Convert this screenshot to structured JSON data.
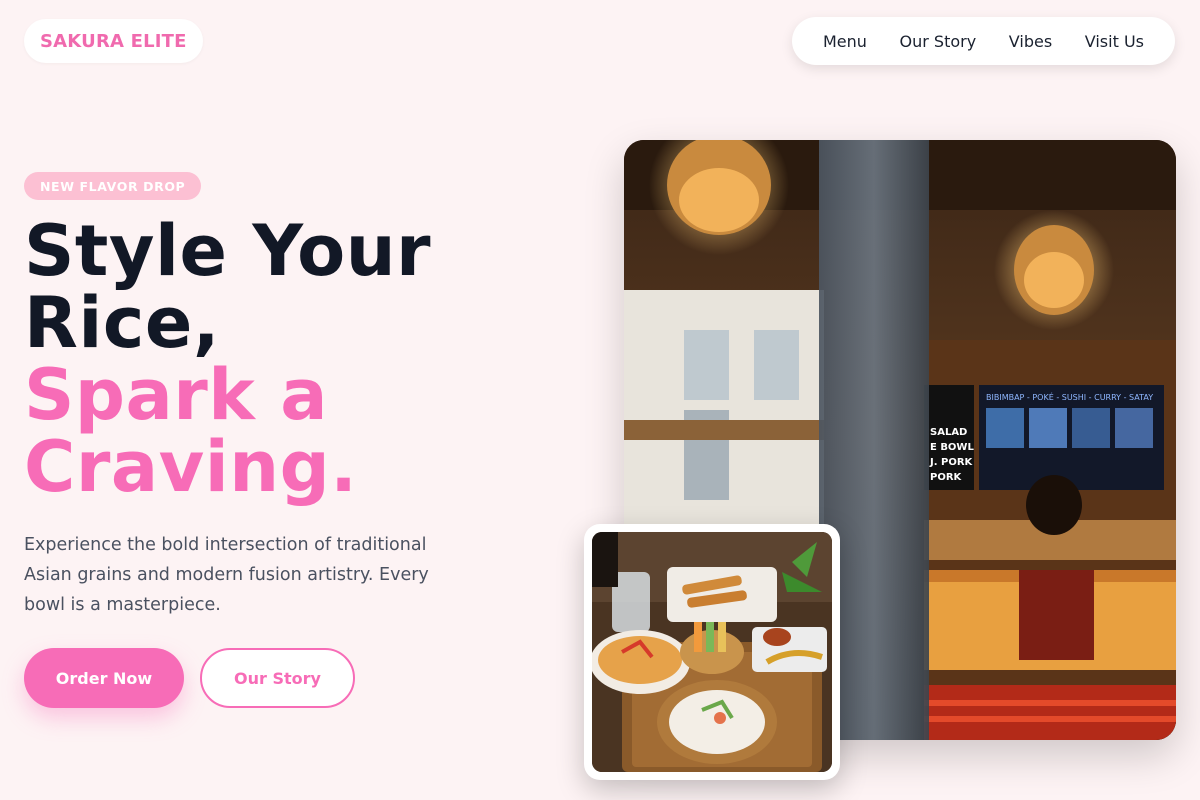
{
  "brand": {
    "name": "SAKURA ELITE"
  },
  "nav": {
    "items": [
      {
        "label": "Menu"
      },
      {
        "label": "Our Story"
      },
      {
        "label": "Vibes"
      },
      {
        "label": "Visit Us"
      }
    ]
  },
  "hero": {
    "badge": "NEW FLAVOR DROP",
    "headline_dark_1": "Style Your",
    "headline_dark_2": "Rice,",
    "headline_pink_1": "Spark a",
    "headline_pink_2": "Craving.",
    "description": "Experience the bold intersection of traditional Asian grains and modern fusion artistry. Every bowl is a masterpiece.",
    "primary_cta": "Order Now",
    "secondary_cta": "Our Story"
  },
  "media": {
    "main_photo_alt": "restaurant interior photo",
    "menu_board_text": "BIBIMBAP - POKÉ - SUSHI - CURRY - SATAY",
    "sign_lines": [
      "SALAD",
      "E BOWL",
      "J. PORK",
      "PORK"
    ],
    "food_photo_alt": "food platter photo"
  },
  "colors": {
    "accent": "#f76cb7",
    "background": "#fdf3f4",
    "heading": "#121826",
    "badge": "#fcc0d3"
  }
}
